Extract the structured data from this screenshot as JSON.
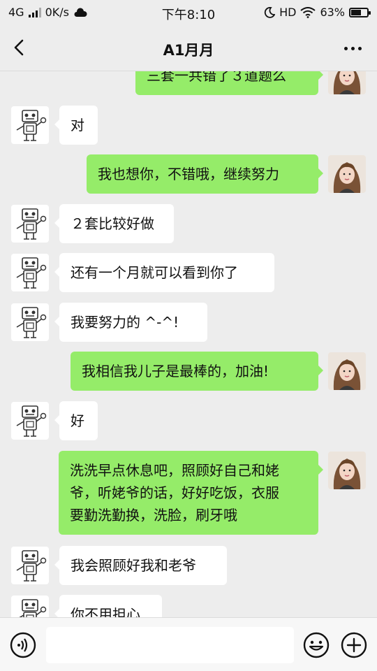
{
  "status": {
    "network": "4G",
    "speed": "0K/s",
    "time": "下午8:10",
    "hd": "HD",
    "battery": "63%",
    "battery_level": 0.63
  },
  "header": {
    "title": "A1月月"
  },
  "messages": [
    {
      "side": "out",
      "text": "三套一共错了３道题么"
    },
    {
      "side": "in",
      "text": "对"
    },
    {
      "side": "out",
      "text": "我也想你，不错哦，继续努力"
    },
    {
      "side": "in",
      "text": "２套比较好做"
    },
    {
      "side": "in",
      "text": "还有一个月就可以看到你了"
    },
    {
      "side": "in",
      "text": "我要努力的 ^-^!"
    },
    {
      "side": "out",
      "text": "我相信我儿子是最棒的，加油!"
    },
    {
      "side": "in",
      "text": "好"
    },
    {
      "side": "out",
      "text": "洗洗早点休息吧，照顾好自己和姥\n爷，听姥爷的话，好好吃饭，衣服\n要勤洗勤换，洗脸，刷牙哦"
    },
    {
      "side": "in",
      "text": "我会照顾好我和老爷"
    },
    {
      "side": "in",
      "text": "你不用担心"
    }
  ],
  "input": {
    "value": ""
  },
  "icons": {
    "back": "back-arrow-icon",
    "more": "more-icon",
    "voice": "voice-icon",
    "emoji": "emoji-icon",
    "plus": "plus-icon"
  }
}
